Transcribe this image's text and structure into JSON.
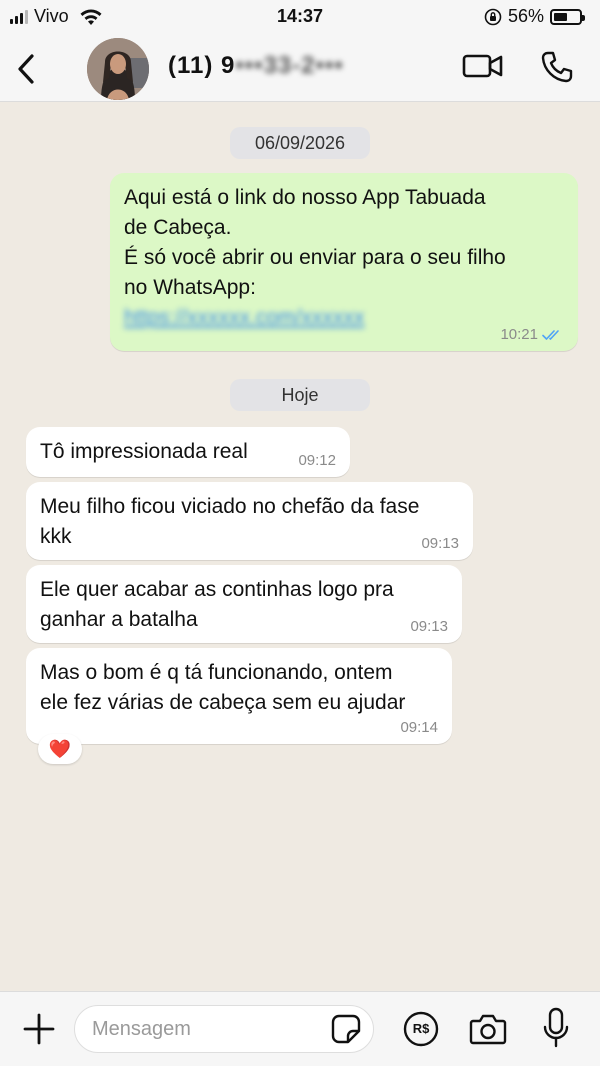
{
  "status_bar": {
    "carrier": "Vivo",
    "time": "14:37",
    "battery_percent": "56%",
    "battery_level": 0.56,
    "icons": [
      "signal-icon",
      "wifi-icon",
      "orientation-lock-icon",
      "battery-icon"
    ]
  },
  "header": {
    "contact_prefix": "(11) 9",
    "contact_masked": "•••33-2•••",
    "icons": [
      "back-chevron-icon",
      "avatar",
      "video-call-icon",
      "phone-icon"
    ]
  },
  "chat": {
    "date_sep_1": "06/09/2026",
    "outgoing": {
      "line1": "Aqui está o link do nosso App Tabuada",
      "line2": "de Cabeça.",
      "line3": "É só você abrir ou enviar para o seu filho",
      "line4": "no WhatsApp:",
      "link": "https://xxxxxx.com/xxxxxx",
      "time": "10:21",
      "status": "read"
    },
    "date_sep_2": "Hoje",
    "messages": [
      {
        "text": "Tô impressionada real",
        "time": "09:12"
      },
      {
        "line1": "Meu filho ficou viciado no chefão da fase",
        "line2": "kkk",
        "time": "09:13"
      },
      {
        "line1": "Ele quer acabar as continhas logo pra",
        "line2": "ganhar a batalha",
        "time": "09:13"
      },
      {
        "line1": "Mas o bom é q tá funcionando, ontem",
        "line2": "ele fez várias de cabeça sem eu ajudar",
        "time": "09:14"
      }
    ],
    "reaction": "❤️"
  },
  "composer": {
    "placeholder": "Mensagem",
    "pix_label": "R$",
    "icons": [
      "plus-icon",
      "sticker-icon",
      "pix-payment-icon",
      "camera-icon",
      "microphone-icon"
    ]
  },
  "colors": {
    "outgoing_bubble": "#dcf8c6",
    "incoming_bubble": "#ffffff",
    "chat_background": "#efeae2",
    "read_ticks": "#4fa3f7"
  }
}
